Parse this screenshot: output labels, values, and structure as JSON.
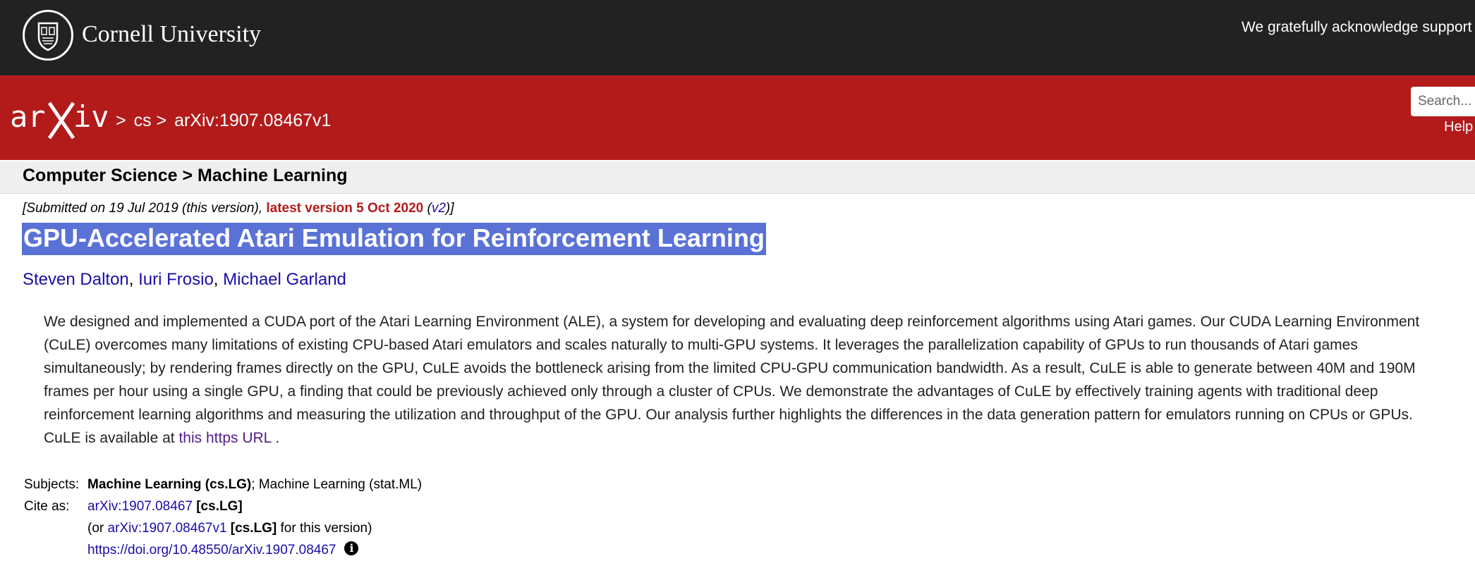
{
  "header": {
    "university_name": "Cornell University",
    "support_text": "We gratefully acknowledge support fron"
  },
  "arxiv_bar": {
    "logo_text": "arXiv",
    "breadcrumb": [
      ">",
      "cs",
      ">",
      "arXiv:1907.08467v1"
    ],
    "search_placeholder": "Search...",
    "help_label": "Help"
  },
  "subheader": "Computer Science > Machine Learning",
  "dateline": {
    "submitted": "[Submitted on 19 Jul 2019 (this version), ",
    "latest": "latest version 5 Oct 2020",
    "open_paren": " (",
    "v2": "v2",
    "close": ")]"
  },
  "paper": {
    "title": "GPU-Accelerated Atari Emulation for Reinforcement Learning",
    "authors": [
      "Steven Dalton",
      "Iuri Frosio",
      "Michael Garland"
    ],
    "author_sep": ", ",
    "abstract": "We designed and implemented a CUDA port of the Atari Learning Environment (ALE), a system for developing and evaluating deep reinforcement algorithms using Atari games. Our CUDA Learning Environment (CuLE) overcomes many limitations of existing CPU-based Atari emulators and scales naturally to multi-GPU systems. It leverages the parallelization capability of GPUs to run thousands of Atari games simultaneously; by rendering frames directly on the GPU, CuLE avoids the bottleneck arising from the limited CPU-GPU communication bandwidth. As a result, CuLE is able to generate between 40M and 190M frames per hour using a single GPU, a finding that could be previously achieved only through a cluster of CPUs. We demonstrate the advantages of CuLE by effectively training agents with traditional deep reinforcement learning algorithms and measuring the utilization and throughput of the GPU. Our analysis further highlights the differences in the data generation pattern for emulators running on CPUs or GPUs. CuLE is available at ",
    "abstract_link": "this https URL",
    "abstract_end": " ."
  },
  "meta": {
    "subjects_label": "Subjects:",
    "subjects_primary": "Machine Learning (cs.LG)",
    "subjects_rest": "; Machine Learning (stat.ML)",
    "cite_label": "Cite as:",
    "cite_id": "arXiv:1907.08467",
    "cite_tag": " [cs.LG]",
    "version_open": "(or ",
    "version_id": "arXiv:1907.08467v1",
    "version_tag": " [cs.LG]",
    "version_close": " for this version)",
    "doi": "https://doi.org/10.48550/arXiv.1907.08467",
    "info_glyph": "i"
  }
}
